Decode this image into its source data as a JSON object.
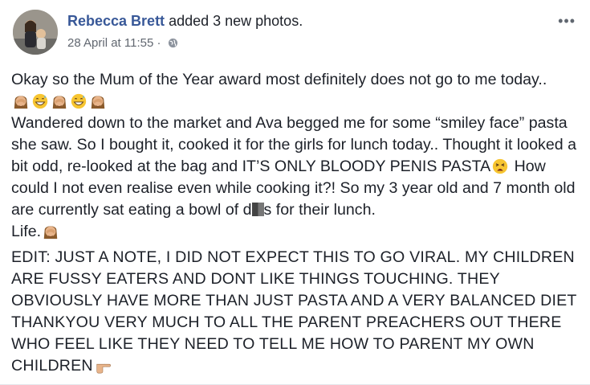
{
  "post": {
    "author": "Rebecca Brett",
    "action": " added 3 new photos.",
    "timestamp": "28 April at 11:55",
    "privacy_separator": " · ",
    "more_menu": "•••"
  },
  "content": {
    "line1": "Okay so the Mum of the Year award most definitely does not go to me today..",
    "para2_a": "Wandered down to the market and Ava begged me for some “smiley face” pasta she saw. So I bought it, cooked it for the girls for lunch today.. Thought it looked a bit odd, re-looked at the bag and IT’S ONLY BLOODY PENIS PASTA",
    "para2_b": " How could I not even realise even while cooking it?! So my 3 year old and 7 month old are currently sat eating a bowl of d",
    "para2_c": "s for their lunch.",
    "life": "Life.",
    "edit": "EDIT: JUST A NOTE, I DID NOT EXPECT THIS TO GO VIRAL. MY CHILDREN ARE FUSSY EATERS AND DONT LIKE THINGS TOUCHING. THEY OBVIOUSLY HAVE MORE THAN JUST PASTA AND A VERY BALANCED DIET THANKYOU VERY MUCH TO ALL THE PARENT PREACHERS OUT THERE WHO FEEL LIKE THEY NEED TO TELL ME HOW TO PARENT MY OWN CHILDREN"
  },
  "icons": {
    "avatar": "profile-photo",
    "emoji_row": [
      "woman-facepalming-emoji",
      "grinning-sweat-emoji",
      "woman-facepalming-emoji",
      "grinning-sweat-emoji",
      "woman-facepalming-emoji"
    ],
    "tired_face": "tired-face-emoji",
    "facepalm": "woman-facepalming-emoji",
    "pointing": "backhand-pointing-emoji",
    "globe": "public-globe-icon"
  },
  "colors": {
    "author_link": "#385898",
    "text": "#1d2129",
    "meta": "#616770"
  }
}
